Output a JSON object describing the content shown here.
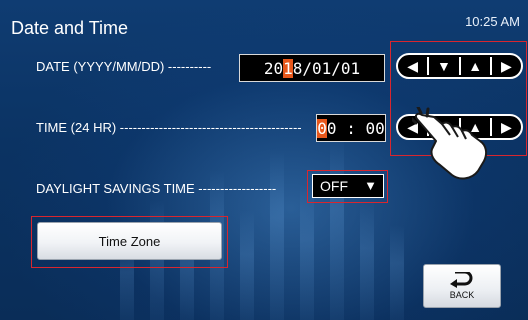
{
  "header": {
    "title": "Date and Time",
    "clock": "10:25 AM"
  },
  "date_row": {
    "label": "DATE (YYYY/MM/DD) ----------",
    "value_before_cursor": "20",
    "cursor_char": "1",
    "value_after_cursor": "8/01/01"
  },
  "time_row": {
    "label": "TIME (24 HR) ------------------------------------------",
    "cursor_char": "0",
    "value_after_cursor": "0 : 00"
  },
  "dst_row": {
    "label": "DAYLIGHT SAVINGS TIME ------------------",
    "value": "OFF",
    "chevron": "▼"
  },
  "arrow_glyphs": {
    "left": "◀",
    "down": "▼",
    "up": "▲",
    "right": "▶"
  },
  "buttons": {
    "time_zone": "Time Zone",
    "back": "BACK"
  },
  "icons": {
    "back": "back-arrow-icon",
    "hand": "pointing-hand-icon"
  },
  "colors": {
    "background": "#0d2f5a",
    "cursor": "#e8581c",
    "highlight_box": "#d9262e"
  }
}
